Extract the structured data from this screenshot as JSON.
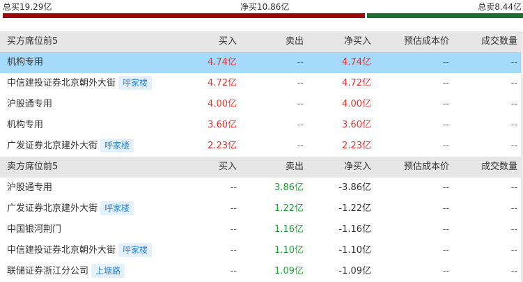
{
  "summary": {
    "total_buy": "总买19.29亿",
    "net_buy": "净买10.86亿",
    "total_sell": "总卖8.44亿",
    "bar_buy_fraction": 0.696,
    "colors": {
      "buy": "#9e0a0a",
      "sell": "#1e6e33"
    }
  },
  "buy_section": {
    "headers": {
      "name": "买方席位前5",
      "buy": "买入",
      "sell": "卖出",
      "net": "净买入",
      "cost": "预估成本价",
      "volume": "成交数量"
    },
    "rows": [
      {
        "name": "机构专用",
        "tag": "",
        "buy": "4.74亿",
        "sell": "--",
        "net": "4.74亿",
        "cost": "--",
        "volume": "--"
      },
      {
        "name": "中信建投证券北京朝外大街",
        "tag": "呼家楼",
        "buy": "4.72亿",
        "sell": "--",
        "net": "4.72亿",
        "cost": "--",
        "volume": "--"
      },
      {
        "name": "沪股通专用",
        "tag": "",
        "buy": "4.00亿",
        "sell": "--",
        "net": "4.00亿",
        "cost": "--",
        "volume": "--"
      },
      {
        "name": "机构专用",
        "tag": "",
        "buy": "3.60亿",
        "sell": "--",
        "net": "3.60亿",
        "cost": "--",
        "volume": "--"
      },
      {
        "name": "广发证券北京建外大街",
        "tag": "呼家楼",
        "buy": "2.23亿",
        "sell": "--",
        "net": "2.23亿",
        "cost": "--",
        "volume": "--"
      }
    ]
  },
  "sell_section": {
    "headers": {
      "name": "卖方席位前5",
      "buy": "买入",
      "sell": "卖出",
      "net": "净买入",
      "cost": "预估成本价",
      "volume": "成交数量"
    },
    "rows": [
      {
        "name": "沪股通专用",
        "tag": "",
        "buy": "--",
        "sell": "3.86亿",
        "net": "-3.86亿",
        "cost": "--",
        "volume": "--"
      },
      {
        "name": "广发证券北京建外大街",
        "tag": "呼家楼",
        "buy": "--",
        "sell": "1.22亿",
        "net": "-1.22亿",
        "cost": "--",
        "volume": "--"
      },
      {
        "name": "中国银河荆门",
        "tag": "",
        "buy": "--",
        "sell": "1.16亿",
        "net": "-1.16亿",
        "cost": "--",
        "volume": "--"
      },
      {
        "name": "中信建投证券北京朝外大街",
        "tag": "呼家楼",
        "buy": "--",
        "sell": "1.10亿",
        "net": "-1.10亿",
        "cost": "--",
        "volume": "--"
      },
      {
        "name": "联储证券浙江分公司",
        "tag": "上塘路",
        "buy": "--",
        "sell": "1.09亿",
        "net": "-1.09亿",
        "cost": "--",
        "volume": "--"
      }
    ]
  }
}
